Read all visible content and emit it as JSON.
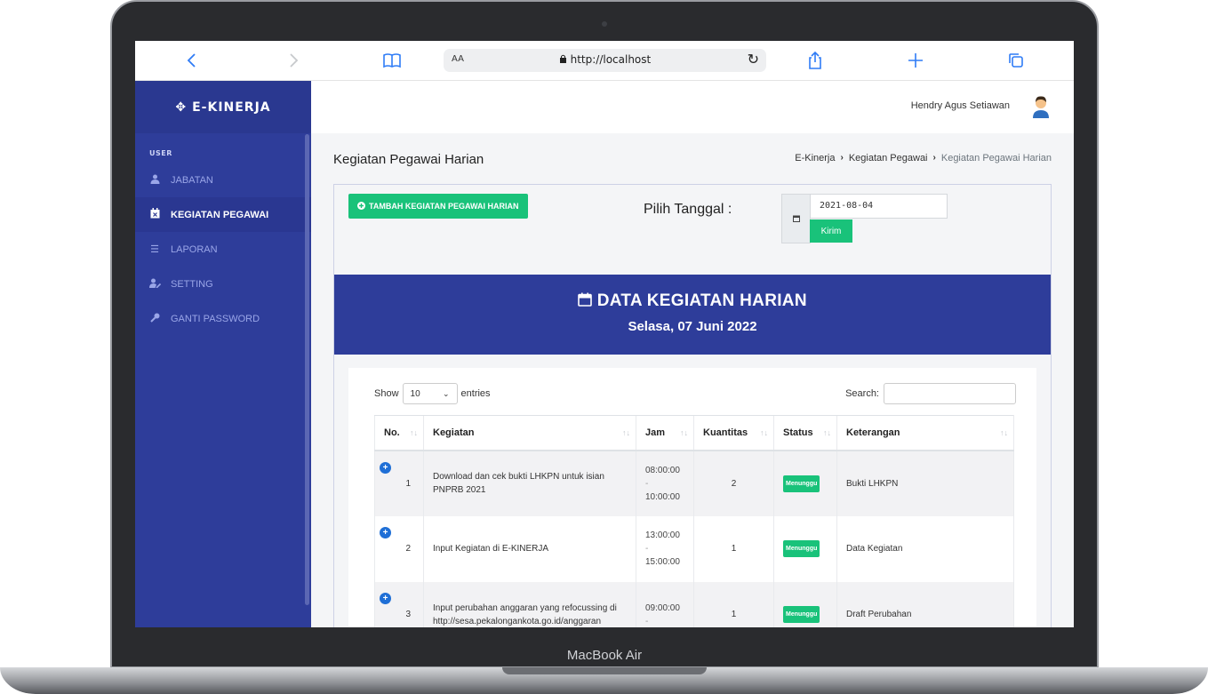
{
  "device": {
    "label": "MacBook Air"
  },
  "browser": {
    "aa_label": "AA",
    "url": "http://localhost",
    "icons": [
      "chevron-left-icon",
      "chevron-right-icon",
      "book-icon",
      "lock-icon",
      "reload-icon",
      "share-icon",
      "plus-icon",
      "tabs-icon"
    ]
  },
  "app": {
    "brand": "E-KINERJA",
    "user_name": "Hendry Agus Setiawan",
    "colors": {
      "primary": "#2e3d9a",
      "success": "#19c27a",
      "link": "#1f6fd6"
    }
  },
  "sidebar": {
    "section": "USER",
    "items": [
      {
        "label": "JABATAN",
        "icon": "user-tie-icon"
      },
      {
        "label": "KEGIATAN PEGAWAI",
        "icon": "calendar-x-icon",
        "active": true
      },
      {
        "label": "LAPORAN",
        "icon": "list-check-icon"
      },
      {
        "label": "SETTING",
        "icon": "user-edit-icon"
      },
      {
        "label": "GANTI PASSWORD",
        "icon": "key-icon"
      }
    ]
  },
  "page": {
    "title": "Kegiatan Pegawai Harian",
    "breadcrumb": [
      "E-Kinerja",
      "Kegiatan Pegawai",
      "Kegiatan Pegawai Harian"
    ]
  },
  "form": {
    "add_button": "TAMBAH KEGIATAN PEGAWAI HARIAN",
    "date_label": "Pilih Tanggal :",
    "date_value": "2021-08-04",
    "submit_button": "Kirim"
  },
  "data_header": {
    "title": "DATA KEGIATAN HARIAN",
    "subtitle": "Selasa, 07 Juni 2022"
  },
  "table": {
    "show_label": "Show",
    "entries_value": "10",
    "entries_label": "entries",
    "search_label": "Search:",
    "columns": [
      "No.",
      "Kegiatan",
      "Jam",
      "Kuantitas",
      "Status",
      "Keterangan"
    ],
    "rows": [
      {
        "no": "1",
        "kegiatan": "Download dan cek bukti LHKPN untuk isian PNPRB 2021",
        "jam_start": "08:00:00",
        "jam_sep": "-",
        "jam_end": "10:00:00",
        "kuantitas": "2",
        "status": "Menunggu",
        "keterangan": "Bukti LHKPN"
      },
      {
        "no": "2",
        "kegiatan": "Input Kegiatan di E-KINERJA",
        "jam_start": "13:00:00",
        "jam_sep": "-",
        "jam_end": "15:00:00",
        "kuantitas": "1",
        "status": "Menunggu",
        "keterangan": "Data Kegiatan"
      },
      {
        "no": "3",
        "kegiatan": "Input perubahan anggaran yang refocussing di http://sesa.pekalongankota.go.id/anggaran",
        "jam_start": "09:00:00",
        "jam_sep": "-",
        "jam_end": "",
        "kuantitas": "1",
        "status": "Menunggu",
        "keterangan": "Draft Perubahan"
      }
    ]
  }
}
